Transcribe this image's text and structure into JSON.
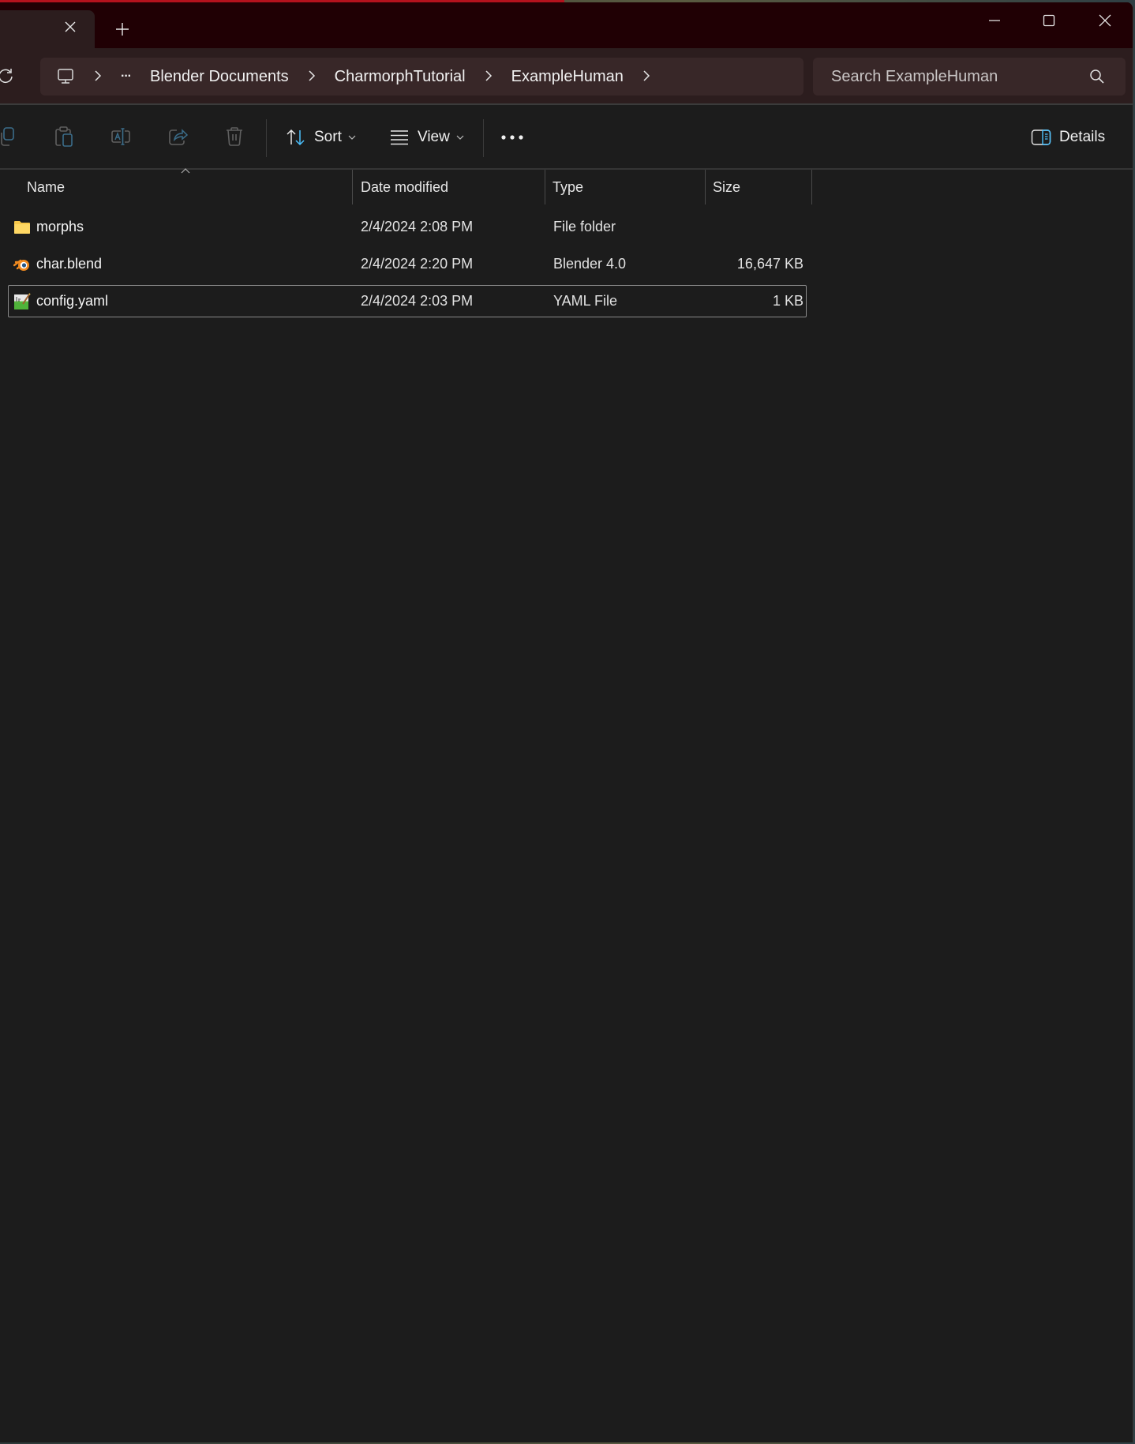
{
  "window": {
    "tab_close_icon": "close-icon",
    "new_tab_icon": "plus-icon",
    "controls": [
      "minimize-icon",
      "maximize-icon",
      "close-icon"
    ]
  },
  "navigation": {
    "refresh_icon": "refresh-icon",
    "breadcrumb": {
      "root_icon": "this-pc-icon",
      "overflow_label": "···",
      "items": [
        {
          "label": "Blender Documents"
        },
        {
          "label": "CharmorphTutorial"
        },
        {
          "label": "ExampleHuman"
        }
      ],
      "separator_icon": "chevron-right-icon"
    },
    "search": {
      "placeholder": "Search ExampleHuman",
      "value": ""
    }
  },
  "toolbar": {
    "icons": [
      "copy-icon",
      "paste-icon",
      "rename-icon",
      "share-icon",
      "delete-icon"
    ],
    "sort_label": "Sort",
    "view_label": "View",
    "more_label": "•••",
    "details_label": "Details"
  },
  "columns": {
    "name": "Name",
    "date_modified": "Date modified",
    "type": "Type",
    "size": "Size",
    "sorted_by": "Name",
    "sort_direction": "ascending"
  },
  "files": [
    {
      "name": "morphs",
      "date_modified": "2/4/2024 2:08 PM",
      "type": "File folder",
      "size": "",
      "icon": "folder-icon",
      "selected": false
    },
    {
      "name": "char.blend",
      "date_modified": "2/4/2024 2:20 PM",
      "type": "Blender 4.0",
      "size": "16,647 KB",
      "icon": "blender-file-icon",
      "selected": false
    },
    {
      "name": "config.yaml",
      "date_modified": "2/4/2024 2:03 PM",
      "type": "YAML File",
      "size": "1 KB",
      "icon": "yaml-file-icon",
      "selected": true
    }
  ],
  "colors": {
    "titlebar_bg": "#200004",
    "tab_active_bg": "#2c1d1e",
    "address_bg": "#382728",
    "content_bg": "#1c1c1c",
    "accent_blue": "#4cc2ff",
    "folder_yellow": "#f8c84a",
    "blender_orange": "#f08a20"
  }
}
